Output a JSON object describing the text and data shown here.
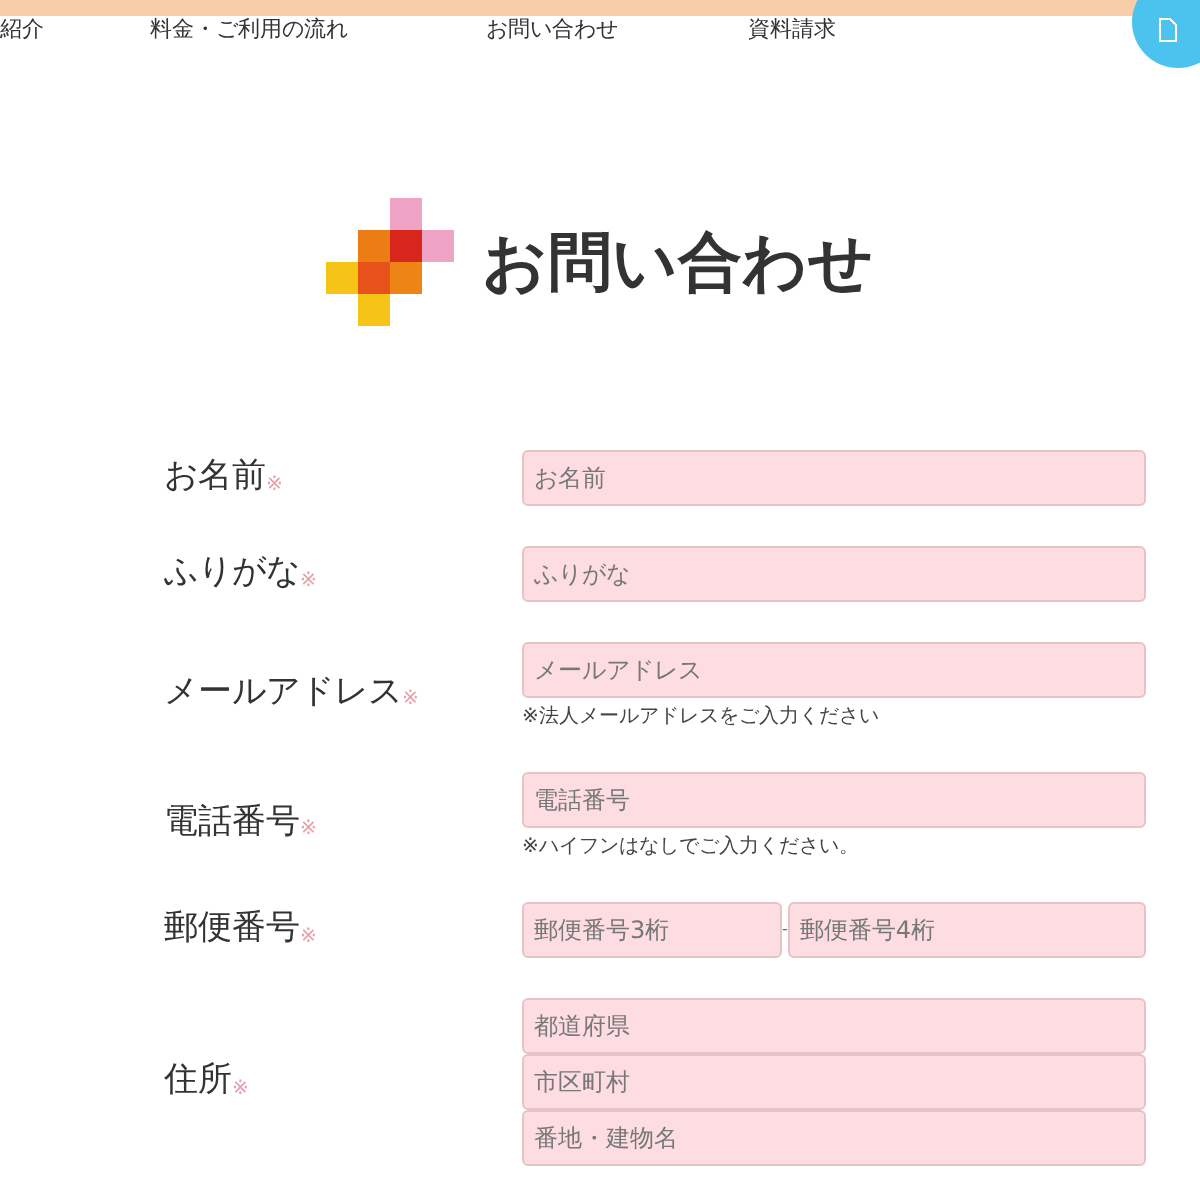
{
  "nav": {
    "items": [
      {
        "label": "紹介"
      },
      {
        "label": "料金・ご利用の流れ"
      },
      {
        "label": "お問い合わせ"
      },
      {
        "label": "資料請求"
      }
    ]
  },
  "heading": {
    "title": "お問い合わせ"
  },
  "form": {
    "fields": [
      {
        "kind": "single",
        "label": "お名前",
        "mark": "※",
        "inputs": [
          {
            "placeholder": "お名前"
          }
        ]
      },
      {
        "kind": "single",
        "label": "ふりがな",
        "mark": "※",
        "inputs": [
          {
            "placeholder": "ふりがな"
          }
        ]
      },
      {
        "kind": "single",
        "label": "メールアドレス",
        "mark": "※",
        "inputs": [
          {
            "placeholder": "メールアドレス"
          }
        ],
        "note": "※法人メールアドレスをご入力ください"
      },
      {
        "kind": "single",
        "label": "電話番号",
        "mark": "※",
        "inputs": [
          {
            "placeholder": "電話番号"
          }
        ],
        "note": "※ハイフンはなしでご入力ください。"
      },
      {
        "kind": "split",
        "label": "郵便番号",
        "mark": "※",
        "separator": "-",
        "inputs": [
          {
            "placeholder": "郵便番号3桁"
          },
          {
            "placeholder": "郵便番号4桁"
          }
        ]
      },
      {
        "kind": "stack",
        "label": "住所",
        "mark": "※",
        "inputs": [
          {
            "placeholder": "都道府県"
          },
          {
            "placeholder": "市区町村"
          },
          {
            "placeholder": "番地・建物名"
          }
        ]
      }
    ]
  }
}
